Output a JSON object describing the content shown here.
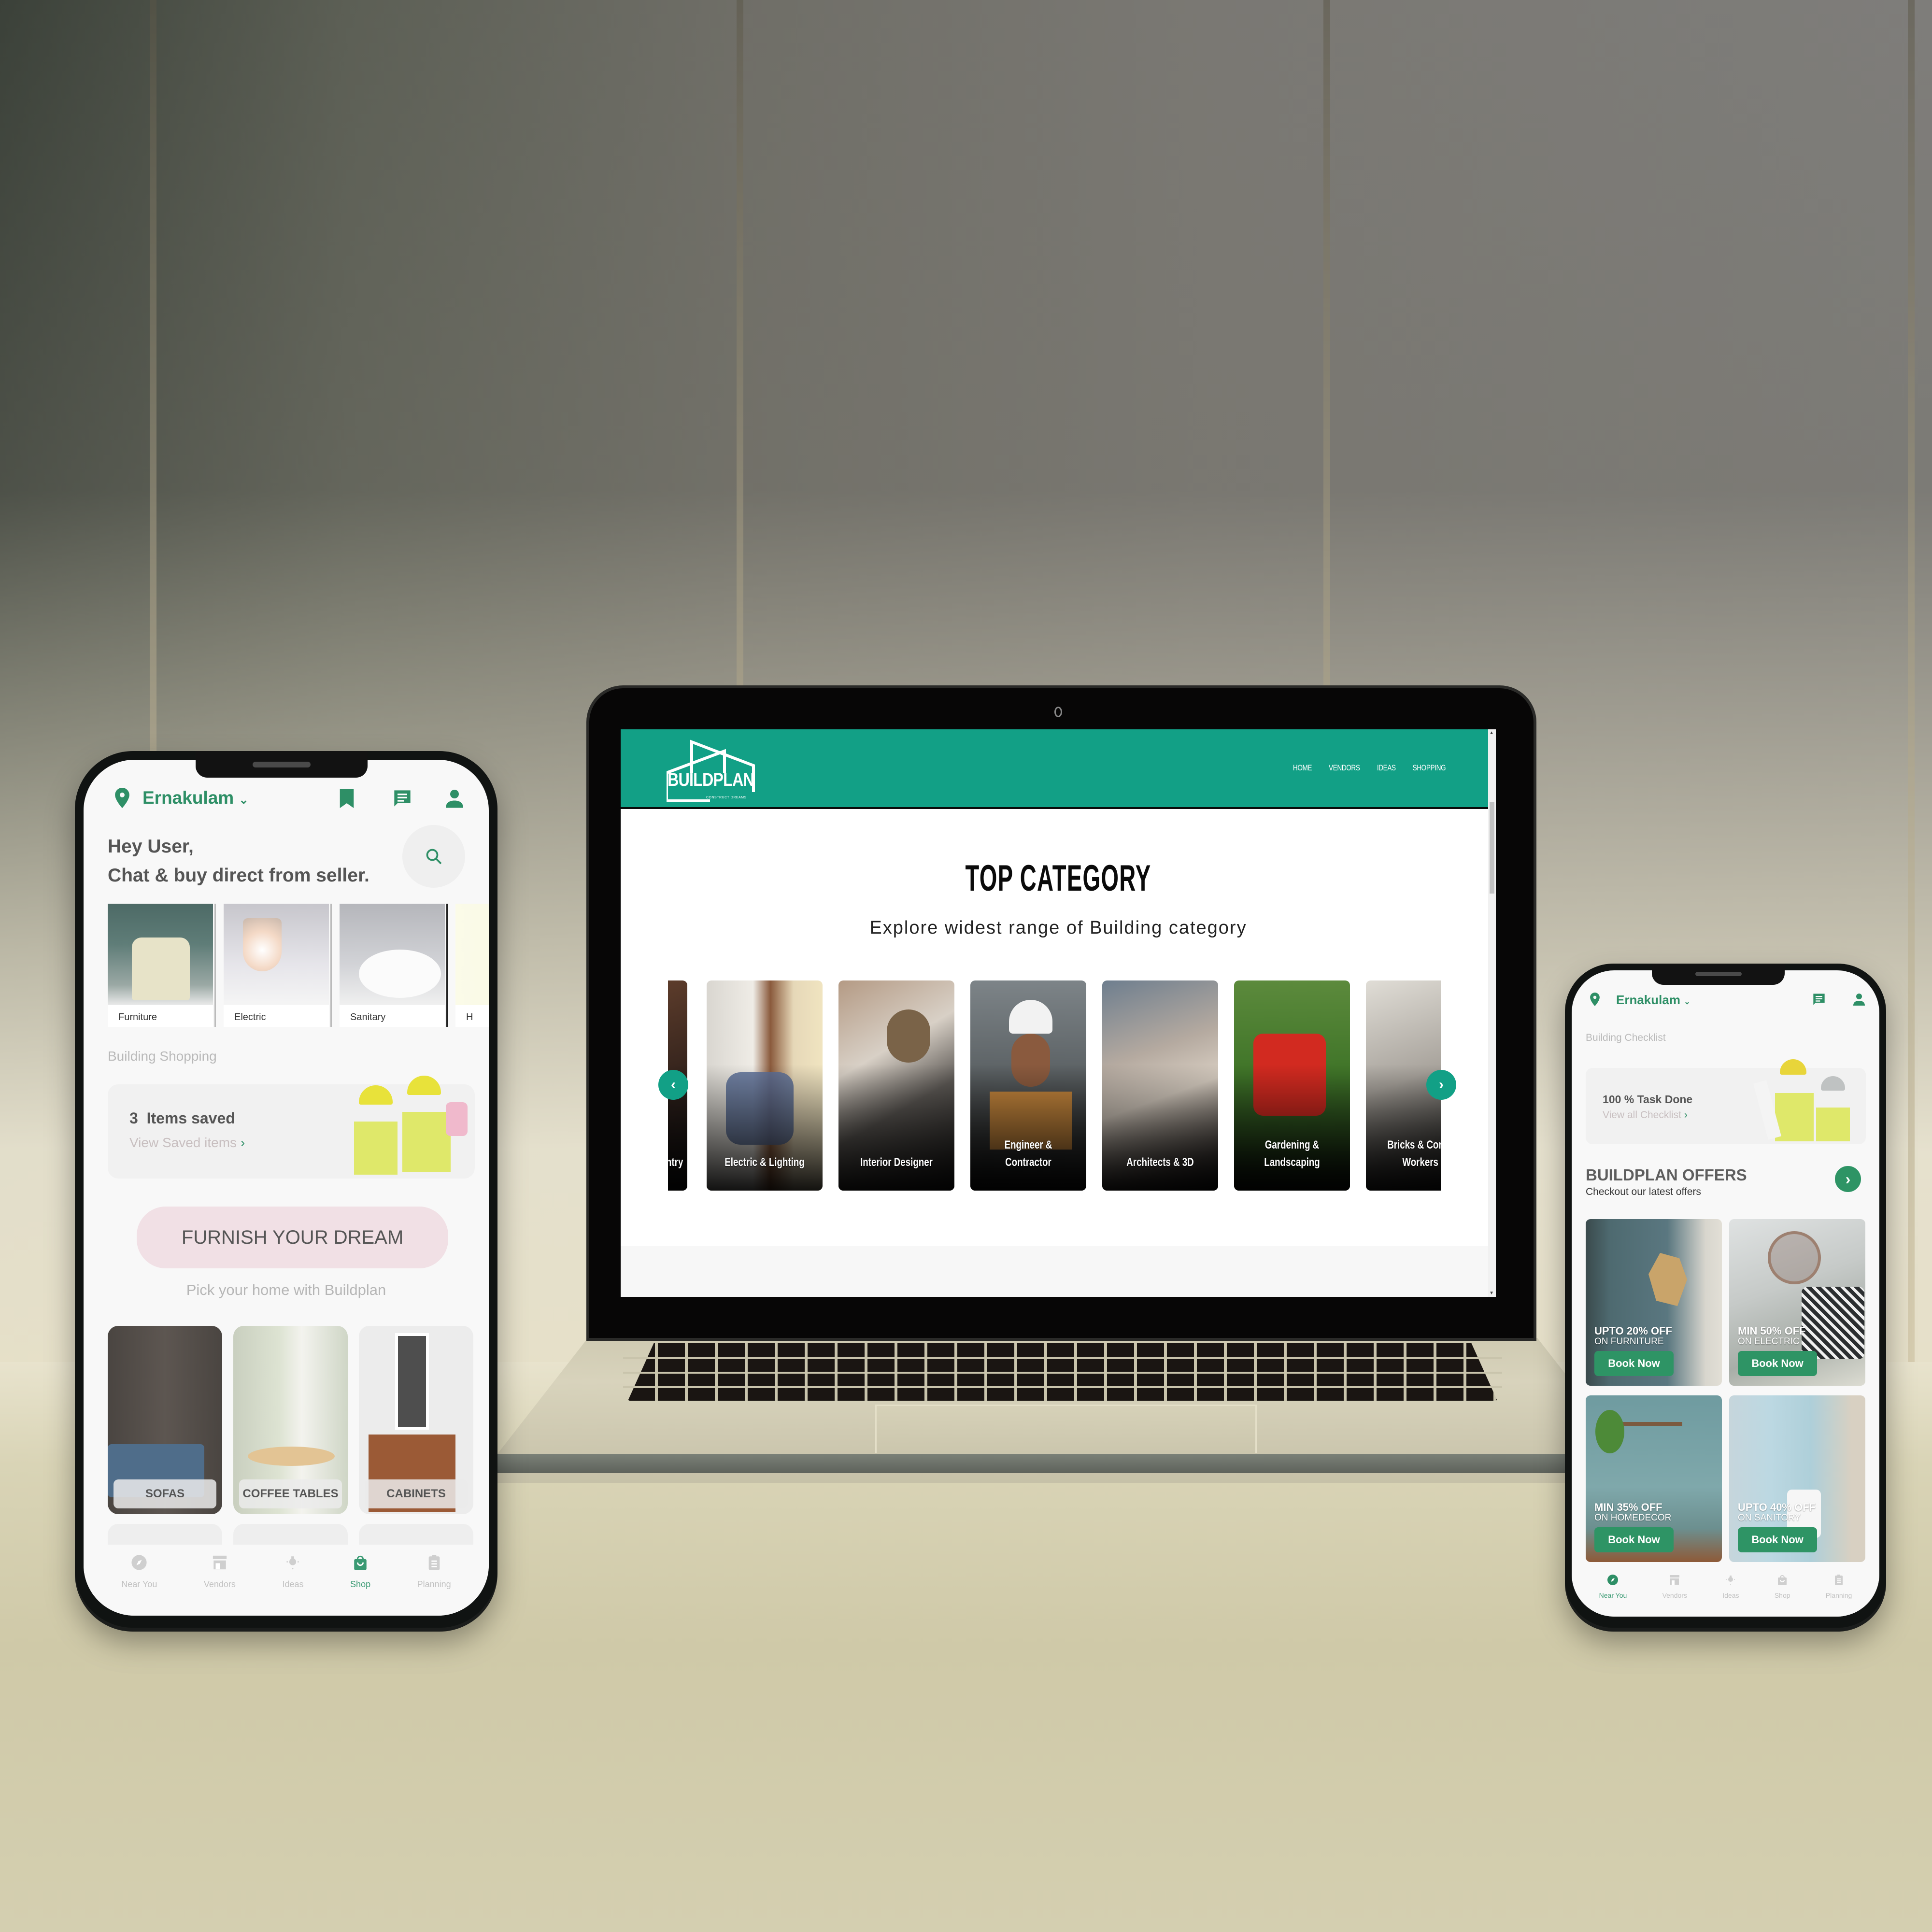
{
  "brand": {
    "name": "BUILDPLAN",
    "tagline": "CONSTRUCT DREAMS",
    "accent_color": "#12a086",
    "app_green": "#2e8f66"
  },
  "laptop": {
    "website": {
      "nav": [
        "HOME",
        "VENDORS",
        "IDEAS",
        "SHOPPING"
      ],
      "section_title": "TOP CATEGORY",
      "section_subtitle": "Explore widest range of Building category",
      "categories": [
        {
          "label": "Carpentry",
          "visible_text": "ntry"
        },
        {
          "label": "Electric & Lighting"
        },
        {
          "label": "Interior Designer"
        },
        {
          "label": "Engineer & Contractor"
        },
        {
          "label": "Architects & 3D"
        },
        {
          "label": "Gardening & Landscaping"
        },
        {
          "label": "Bricks & Concrete Workers",
          "visible_text": "Bricks & Con Workers"
        }
      ],
      "prev_icon": "chevron-left",
      "next_icon": "chevron-right"
    }
  },
  "phone_left": {
    "location": "Ernakulam",
    "greeting_line1": "Hey User,",
    "greeting_line2": "Chat & buy direct from seller.",
    "categories": [
      {
        "label": "Furniture"
      },
      {
        "label": "Electric"
      },
      {
        "label": "Sanitary"
      },
      {
        "label": "Home Decor",
        "visible_text": "H"
      }
    ],
    "section_label": "Building Shopping",
    "saved": {
      "count": "3",
      "count_label": "Items saved",
      "link": "View Saved items"
    },
    "cta_button": "FURNISH YOUR DREAM",
    "cta_sub": "Pick your home with Buildplan",
    "products": [
      {
        "label": "SOFAS"
      },
      {
        "label": "COFFEE TABLES"
      },
      {
        "label": "CABINETS"
      }
    ],
    "bottom_nav": [
      {
        "label": "Near You",
        "icon": "compass",
        "active": false
      },
      {
        "label": "Vendors",
        "icon": "store",
        "active": false
      },
      {
        "label": "Ideas",
        "icon": "bulb",
        "active": false
      },
      {
        "label": "Shop",
        "icon": "shopping-bag",
        "active": true
      },
      {
        "label": "Planning",
        "icon": "clipboard",
        "active": false
      }
    ]
  },
  "phone_right": {
    "location": "Ernakulam",
    "section_label": "Building Checklist",
    "checklist": {
      "status": "100 % Task Done",
      "progress_percent": 100,
      "link": "View all Checklist"
    },
    "offers_title": "BUILDPLAN OFFERS",
    "offers_sub": "Checkout our latest offers",
    "offers": [
      {
        "title": "UPTO 20% OFF",
        "subtitle": "ON FURNITURE",
        "button": "Book Now"
      },
      {
        "title": "MIN 50% OFF",
        "subtitle": "ON ELECTRIC",
        "button": "Book Now"
      },
      {
        "title": "MIN 35% OFF",
        "subtitle": "ON HOMEDECOR",
        "button": "Book Now"
      },
      {
        "title": "UPTO 40% OFF",
        "subtitle": "ON SANITORY",
        "button": "Book Now"
      }
    ],
    "bottom_nav": [
      {
        "label": "Near You",
        "icon": "compass",
        "active": true
      },
      {
        "label": "Vendors",
        "icon": "store",
        "active": false
      },
      {
        "label": "Ideas",
        "icon": "bulb",
        "active": false
      },
      {
        "label": "Shop",
        "icon": "shopping-bag",
        "active": false
      },
      {
        "label": "Planning",
        "icon": "clipboard",
        "active": false
      }
    ]
  }
}
